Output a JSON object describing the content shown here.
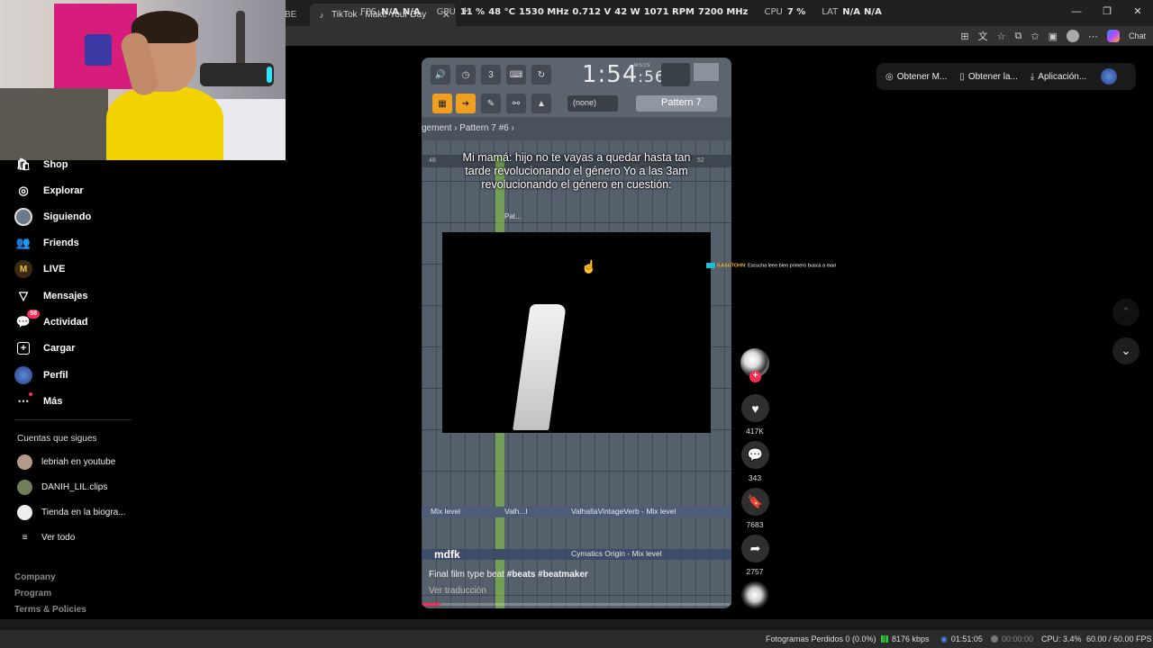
{
  "browser": {
    "prev_tab_label": "BE",
    "active_tab_title": "TikTok - Make Your Day",
    "chat_label": "Chat"
  },
  "overlay_stats": {
    "fps_label": "FPS",
    "fps_value": "N/A",
    "fps_value2": "N/A",
    "gpu_label": "GPU",
    "gpu_load": "11 %",
    "gpu_temp": "48 °C",
    "gpu_clock": "1530 MHz",
    "gpu_volt": "0.712 V",
    "gpu_power": "42 W",
    "gpu_rpm": "1071 RPM",
    "gpu_mem": "7200 MHz",
    "cpu_label": "CPU",
    "cpu_value": "7 %",
    "lat_label": "LAT",
    "lat_value": "N/A",
    "lat_value2": "N/A"
  },
  "sidebar": {
    "items": [
      {
        "label": "Shop",
        "icon": "shop-icon"
      },
      {
        "label": "Explorar",
        "icon": "compass-icon"
      },
      {
        "label": "Siguiendo",
        "icon": "following-avatar-icon"
      },
      {
        "label": "Friends",
        "icon": "friends-icon"
      },
      {
        "label": "LIVE",
        "icon": "live-icon"
      },
      {
        "label": "Mensajes",
        "icon": "send-icon"
      },
      {
        "label": "Actividad",
        "icon": "activity-icon",
        "badge": "58"
      },
      {
        "label": "Cargar",
        "icon": "upload-icon"
      },
      {
        "label": "Perfil",
        "icon": "profile-avatar-icon"
      },
      {
        "label": "Más",
        "icon": "more-icon"
      }
    ],
    "following_title": "Cuentas que sigues",
    "following": [
      {
        "name": "lebriah en youtube"
      },
      {
        "name": "DANIH_LIL.clips"
      },
      {
        "name": "Tienda en la biogra..."
      }
    ],
    "see_all": "Ver todo",
    "footer": [
      "Company",
      "Program",
      "Terms & Policies"
    ]
  },
  "topbar": {
    "get_coins": "Obtener M...",
    "get_app": "Obtener la...",
    "app_label": "Aplicación..."
  },
  "video": {
    "fl": {
      "time_main": "1:54",
      "time_sec": "56",
      "time_unit": "M:S:CS",
      "none_label": "(none)",
      "pattern_label": "Pattern 7",
      "breadcrumb": "gement › Pattern 7 #6 ›",
      "ruler_left": "48",
      "ruler_right": "52",
      "pat_label": "Pat..."
    },
    "caption": "Mi mamá: hijo no te vayas a quedar hasta tan tarde revolucionando el género Yo a las 3am revolucionando el género en cuestión:",
    "mix_left": "Mix level",
    "mix_mid": "Valh...l",
    "mix_right": "ValhallaVintageVerb - Mix level",
    "mix_bottom": "Cymatics Origin - Mix level",
    "handle": "mdfk",
    "description_pre": "Final film type beat ",
    "hashtags": "#beats #beatmaker",
    "translate": "Ver traducción",
    "progress": 0.06
  },
  "chat_overlay": {
    "name": "KASUTOHN",
    "message": ": Escucha leee bien primero busca a mari"
  },
  "actions": {
    "likes": "417K",
    "comments": "343",
    "saves": "7683",
    "shares": "2757"
  },
  "obs_status": {
    "dropped_frames": "Fotogramas Perdidos 0 (0.0%)",
    "bitrate": "8176 kbps",
    "stream_time": "01:51:05",
    "rec_time": "00:00:00",
    "cpu": "CPU: 3.4%",
    "fps": "60.00 / 60.00 FPS"
  },
  "colors": {
    "accent": "#fe2c55",
    "fl_orange": "#f0a020",
    "playhead_green": "#8cd246"
  }
}
